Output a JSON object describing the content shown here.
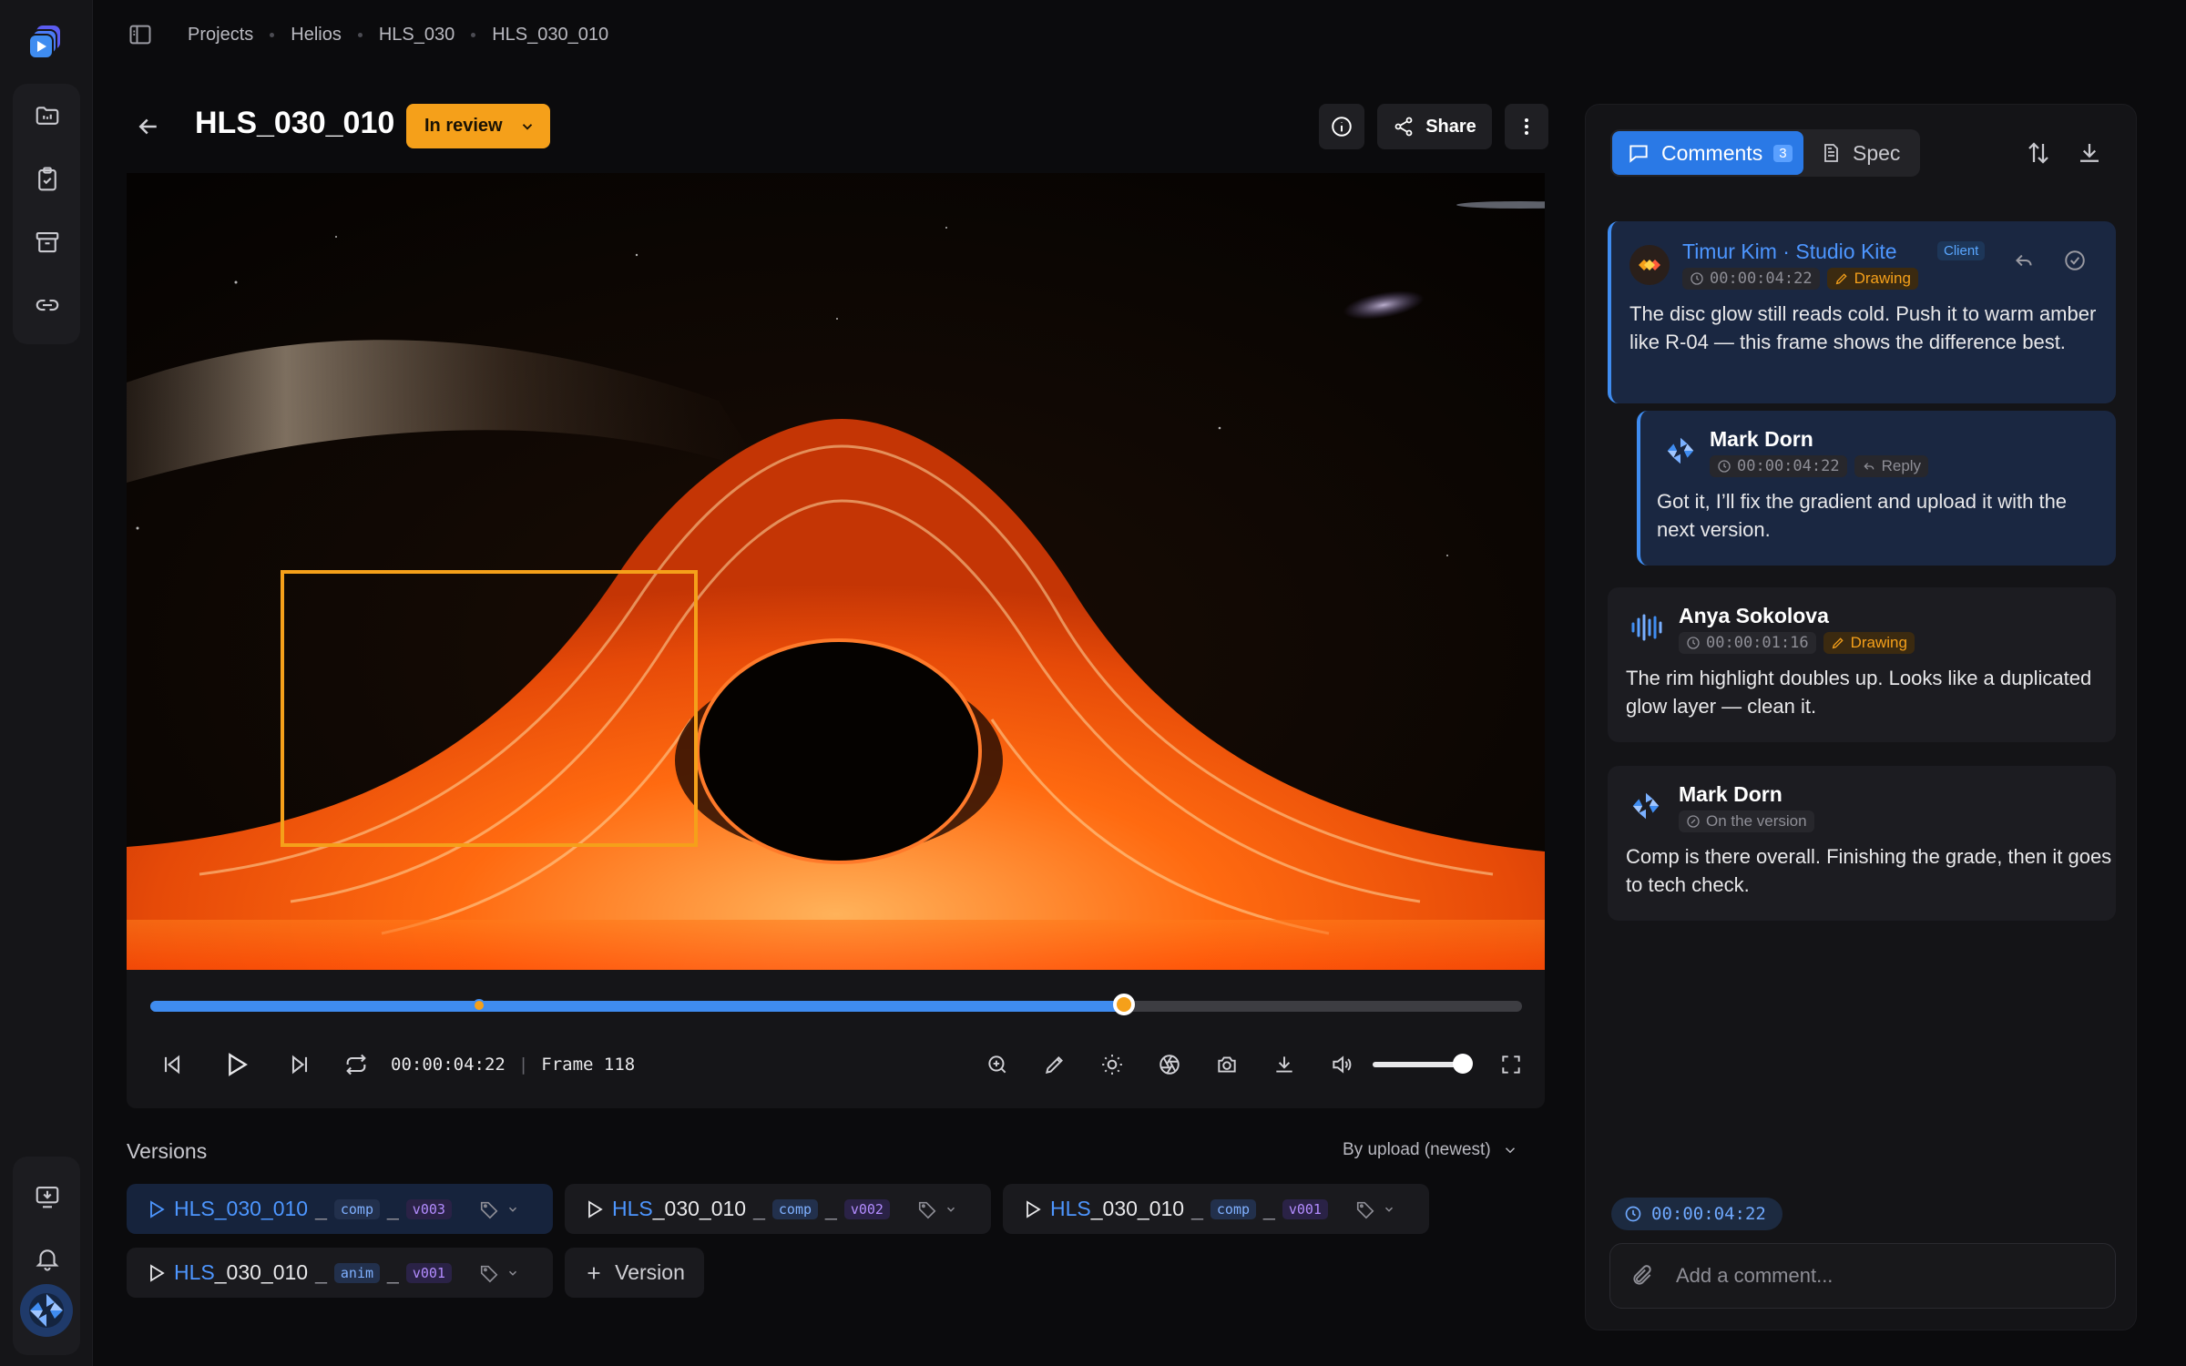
{
  "breadcrumbs": [
    "Projects",
    "Helios",
    "HLS_030",
    "HLS_030_010"
  ],
  "header": {
    "title": "HLS_030_010",
    "status": "In review",
    "share_label": "Share"
  },
  "player": {
    "timecode": "00:00:04:22",
    "frame": "Frame 118",
    "progress": 0.71,
    "marker": 0.24,
    "volume": 1.0
  },
  "versions": {
    "label": "Versions",
    "sort": "By upload (newest)",
    "add_label": "Version",
    "items": [
      {
        "prefix": "HLS_030_010",
        "sep": "_",
        "dept": "comp",
        "sep2": "_",
        "ver": "v003",
        "active": true
      },
      {
        "prefix": "HLS",
        "rest": "_030_010",
        "sep": "_",
        "dept": "comp",
        "sep2": "_",
        "ver": "v002"
      },
      {
        "prefix": "HLS",
        "rest": "_030_010",
        "sep": "_",
        "dept": "comp",
        "sep2": "_",
        "ver": "v001"
      },
      {
        "prefix": "HLS",
        "rest": "_030_010",
        "sep": "_",
        "dept": "anim",
        "sep2": "_",
        "ver": "v001"
      }
    ]
  },
  "panel": {
    "tab_comments": "Comments",
    "comment_count": "3",
    "tab_spec": "Spec",
    "comments": [
      {
        "name": "Timur Kim · Studio Kite",
        "badge": "Client",
        "time": "00:00:04:22",
        "tag": "Drawing",
        "body": "The disc glow still reads cold. Push it to warm amber like R-04 — this frame shows the difference best."
      },
      {
        "name": "Mark Dorn",
        "time": "00:00:04:22",
        "tag": "Reply",
        "body": "Got it, I’ll fix the gradient and upload it with the next version."
      },
      {
        "name": "Anya Sokolova",
        "time": "00:00:01:16",
        "tag": "Drawing",
        "body": "The rim highlight doubles up. Looks like a duplicated glow layer — clean it."
      },
      {
        "name": "Mark Dorn",
        "tag": "On the version",
        "body": "Comp is there overall. Finishing the grade, then it goes to tech check."
      }
    ],
    "composer_time": "00:00:04:22",
    "composer_placeholder": "Add a comment..."
  }
}
